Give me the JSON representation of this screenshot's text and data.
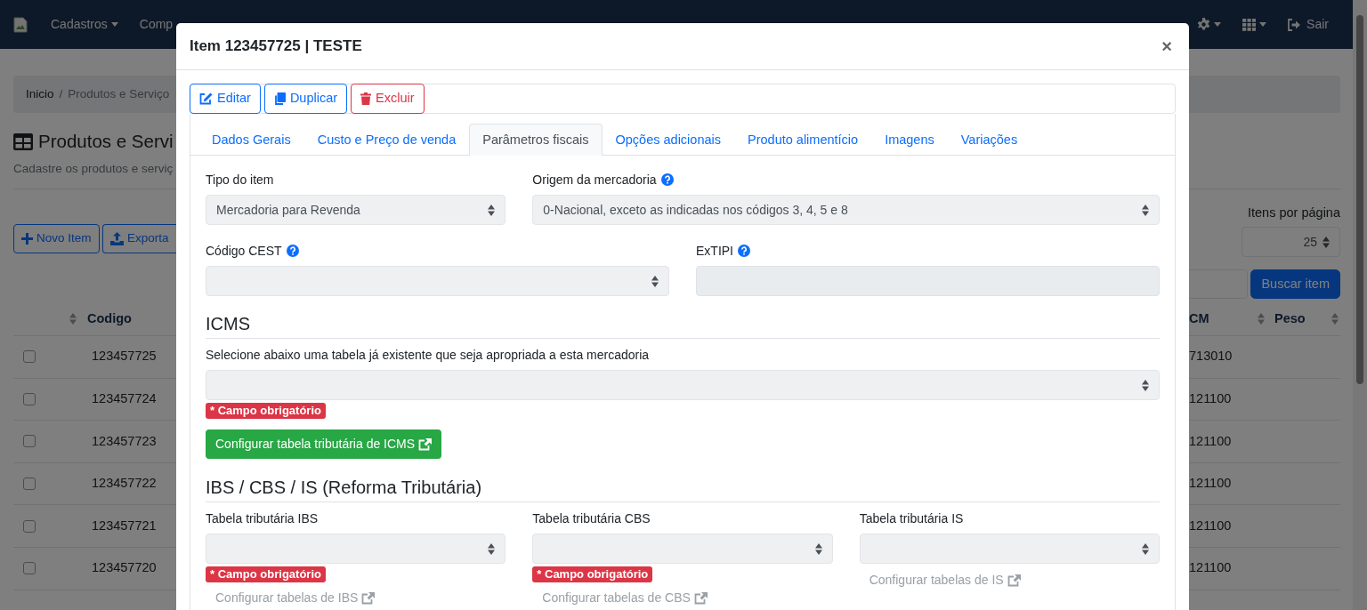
{
  "navbar": {
    "menus": [
      {
        "label": "Cadastros",
        "dropdown": true
      },
      {
        "label": "Comp",
        "dropdown": false
      }
    ],
    "tools": [
      {
        "kind": "settings"
      },
      {
        "kind": "apps"
      }
    ],
    "logout": "Sair"
  },
  "page": {
    "breadcrumb": [
      {
        "label": "Inicio",
        "link": true
      },
      {
        "label": "Produtos e Serviço",
        "link": false
      }
    ],
    "breadcrumb_separator": "/",
    "title": "Produtos e Servi",
    "subtitle": "Cadastre os produtos e serviç",
    "buttons": [
      {
        "label": "Novo Item",
        "kind": "add"
      },
      {
        "label": "Exporta",
        "kind": "export"
      }
    ],
    "per_page_label": "Itens por página",
    "per_page": "25",
    "search_button": "Buscar item",
    "columns": [
      {
        "label": "Codigo"
      },
      {
        "label": "CM"
      },
      {
        "label": "Peso"
      }
    ],
    "rows": [
      {
        "checked": false,
        "cells": [
          "123457725",
          "713010"
        ]
      },
      {
        "checked": false,
        "cells": [
          "123457724",
          "121100"
        ]
      },
      {
        "checked": false,
        "cells": [
          "123457723",
          "121100"
        ]
      },
      {
        "checked": false,
        "cells": [
          "123457722",
          "121100"
        ]
      },
      {
        "checked": false,
        "cells": [
          "123457721",
          "121100"
        ]
      },
      {
        "checked": false,
        "cells": [
          "123457720",
          "121100"
        ]
      }
    ]
  },
  "modal": {
    "title": "Item 123457725 | TESTE",
    "close": "×",
    "actions": [
      {
        "label": "Editar",
        "kind": "edit"
      },
      {
        "label": "Duplicar",
        "kind": "copy"
      },
      {
        "label": "Excluir",
        "kind": "delete"
      }
    ],
    "tabs": [
      {
        "label": "Dados Gerais",
        "selected": false
      },
      {
        "label": "Custo e Preço de venda",
        "selected": false
      },
      {
        "label": "Parâmetros fiscais",
        "selected": true
      },
      {
        "label": "Opções adicionais",
        "selected": false
      },
      {
        "label": "Produto alimentício",
        "selected": false
      },
      {
        "label": "Imagens",
        "selected": false
      },
      {
        "label": "Variações",
        "selected": false
      }
    ],
    "row1": [
      {
        "label": "Tipo do item",
        "help": false,
        "kind": "select",
        "value": "Mercadoria para Revenda",
        "disabled": true
      },
      {
        "label": "Origem da mercadoria",
        "help": true,
        "kind": "select",
        "value": "0-Nacional, exceto as indicadas nos códigos 3, 4, 5 e 8",
        "disabled": true
      }
    ],
    "row2": [
      {
        "label": "Código CEST",
        "help": true,
        "kind": "select",
        "disabled": true
      },
      {
        "label": "ExTIPI",
        "help": true,
        "kind": "input",
        "disabled": true
      }
    ],
    "icms": {
      "heading": "ICMS",
      "label": "Selecione abaixo uma tabela já existente que seja apropriada a esta mercadoria",
      "disabled": true,
      "required": "* Campo obrigatório",
      "button": "Configurar tabela tributária de ICMS"
    },
    "reform": {
      "heading": "IBS / CBS / IS (Reforma Tributária)",
      "tables": [
        {
          "label": "Tabela tributária IBS",
          "disabled": true,
          "required": "* Campo obrigatório",
          "link": "Configurar tabelas de IBS",
          "link_disabled": true
        },
        {
          "label": "Tabela tributária CBS",
          "disabled": true,
          "required": "* Campo obrigatório",
          "link": "Configurar tabelas de CBS",
          "link_disabled": true
        },
        {
          "label": "Tabela tributária IS",
          "disabled": true,
          "link": "Configurar tabelas de IS",
          "link_disabled": true
        }
      ]
    }
  }
}
